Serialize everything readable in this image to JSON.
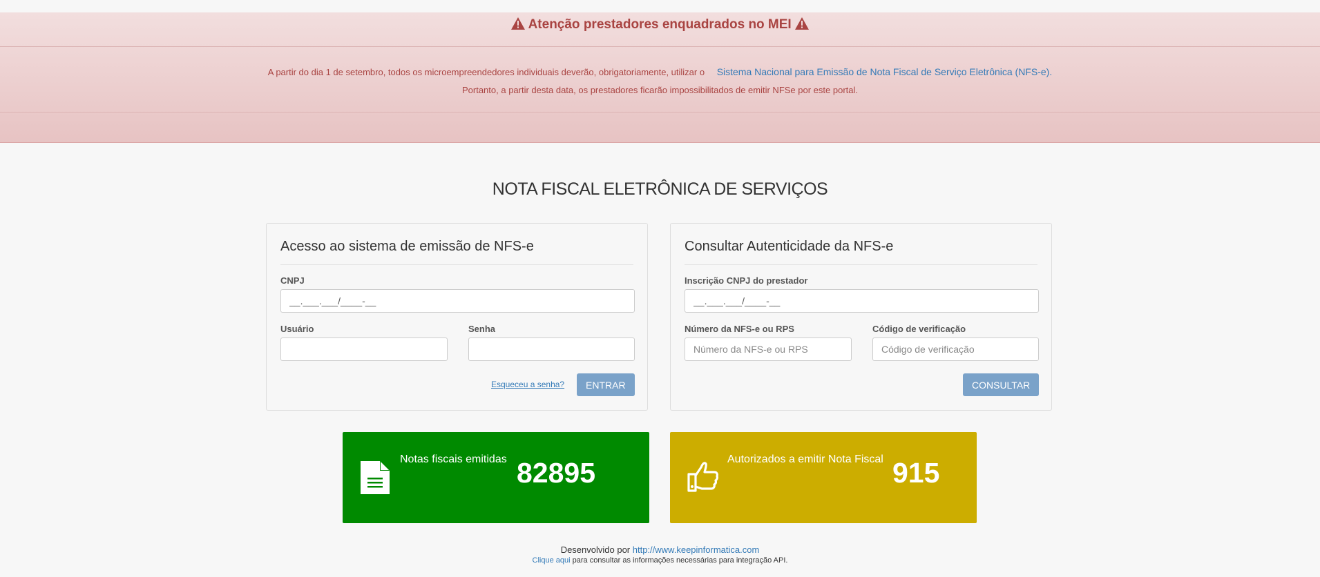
{
  "alert": {
    "title": "Atenção prestadores enquadrados no MEI",
    "line1_text": "A partir do dia 1 de setembro, todos os microempreendedores individuais deverão, obrigatoriamente, utilizar o",
    "line1_link": "Sistema Nacional para Emissão de Nota Fiscal de Serviço Eletrônica (NFS-e).",
    "line2_text": "Portanto, a partir desta data, os prestadores ficarão impossibilitados de emitir NFSe por este portal.",
    "icon": "warning-triangle-icon",
    "color": "#a94442"
  },
  "page": {
    "title": "NOTA FISCAL ELETRÔNICA DE SERVIÇOS"
  },
  "login": {
    "title": "Acesso ao sistema de emissão de NFS-e",
    "cnpj_label": "CNPJ",
    "cnpj_value": "__.___.___/____-__",
    "user_label": "Usuário",
    "user_value": "",
    "password_label": "Senha",
    "password_value": "",
    "forgot_link": "Esqueceu a senha?",
    "submit_label": "ENTRAR"
  },
  "verify": {
    "title": "Consultar Autenticidade da NFS-e",
    "cnpj_label": "Inscrição CNPJ do prestador",
    "cnpj_value": "__.___.___/____-__",
    "number_label": "Número da NFS-e ou RPS",
    "number_placeholder": "Número da NFS-e ou RPS",
    "code_label": "Código de verificação",
    "code_placeholder": "Código de verificação",
    "submit_label": "CONSULTAR"
  },
  "stats": [
    {
      "label": "Notas fiscais emitidas",
      "value": "82895",
      "icon": "document-icon",
      "color": "#008a00"
    },
    {
      "label": "Autorizados a emitir Nota Fiscal",
      "value": "915",
      "icon": "thumbs-up-icon",
      "color": "#ccad00"
    }
  ],
  "footer": {
    "developed_by": "Desenvolvido por",
    "developer_link": "http://www.keepinformatica.com",
    "api_link": "Clique aqui",
    "api_text": "para consultar as informações necessárias para integração API."
  },
  "colors": {
    "button": "#7aa2c9",
    "link": "#337ab7",
    "background": "#f7f7f7"
  }
}
